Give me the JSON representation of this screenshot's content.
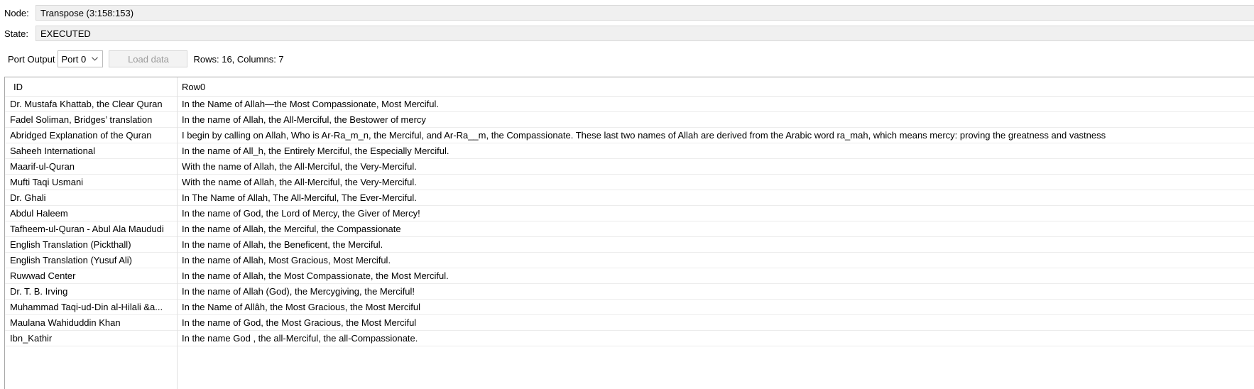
{
  "node": {
    "label": "Node:",
    "value": "Transpose  (3:158:153)"
  },
  "state": {
    "label": "State:",
    "value": "EXECUTED"
  },
  "toolbar": {
    "port_output_label": "Port Output",
    "port_select_value": "Port 0",
    "load_button_label": "Load data",
    "rows_info": "Rows: 16, Columns: 7"
  },
  "table": {
    "headers": [
      "ID",
      "Row0"
    ],
    "rows": [
      [
        "Dr. Mustafa Khattab, the Clear Quran",
        "In the Name of Allah—the Most Compassionate, Most Merciful."
      ],
      [
        "Fadel Soliman, Bridges’ translation",
        "In the name of Allah, the All-Merciful, the Bestower of mercy"
      ],
      [
        "Abridged Explanation of the Quran",
        "I begin by calling on Allah, Who is Ar-Ra_m_n, the Merciful, and Ar-Ra__m, the Compassionate. These last two names of Allah are derived from the Arabic word ra_mah, which means mercy: proving the greatness and vastness"
      ],
      [
        "Saheeh International",
        "In the name of All_h, the Entirely Merciful, the Especially Merciful."
      ],
      [
        "Maarif-ul-Quran",
        "With the name of Allah, the All-Merciful, the Very-Merciful."
      ],
      [
        "Mufti Taqi Usmani",
        "With the name of Allah, the All-Merciful, the Very-Merciful."
      ],
      [
        "Dr. Ghali",
        "In The Name of Allah, The All-Merciful, The Ever-Merciful."
      ],
      [
        "Abdul Haleem",
        "In the name of God, the Lord of Mercy, the Giver of Mercy!"
      ],
      [
        "Tafheem-ul-Quran - Abul Ala Maududi",
        "In the name of Allah, the Merciful, the Compassionate"
      ],
      [
        "English Translation (Pickthall)",
        "In the name of Allah, the Beneficent, the Merciful."
      ],
      [
        "English Translation (Yusuf Ali)",
        "In the name of Allah, Most Gracious, Most Merciful."
      ],
      [
        "Ruwwad Center",
        "In the name of Allah, the Most Compassionate, the Most Merciful."
      ],
      [
        "Dr. T. B. Irving",
        "In the name of Allah (God), the Mercygiving, the Merciful!"
      ],
      [
        "Muhammad Taqi-ud-Din al-Hilali &a...",
        "In the Name of Allâh, the Most Gracious, the Most Merciful"
      ],
      [
        "Maulana Wahiduddin Khan",
        "In the name of God, the Most Gracious, the Most Merciful"
      ],
      [
        "Ibn_Kathir",
        "In the name God , the all-Merciful, the all-Compassionate."
      ]
    ]
  }
}
